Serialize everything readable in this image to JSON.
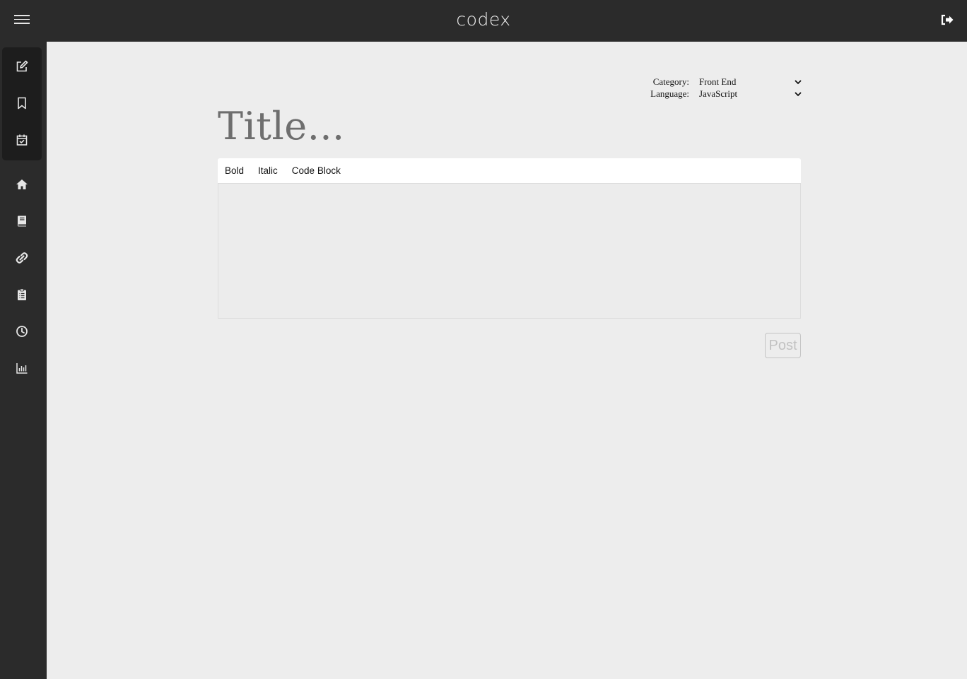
{
  "app": {
    "logo": "codex"
  },
  "header": {
    "menu_icon": "hamburger-menu-icon",
    "logout_icon": "logout-icon"
  },
  "sidebar": {
    "group_items": [
      {
        "icon": "edit-icon"
      },
      {
        "icon": "bookmark-icon"
      },
      {
        "icon": "calendar-check-icon"
      }
    ],
    "items": [
      {
        "icon": "home-icon"
      },
      {
        "icon": "book-icon"
      },
      {
        "icon": "link-icon"
      },
      {
        "icon": "clipboard-list-icon"
      },
      {
        "icon": "clock-icon"
      },
      {
        "icon": "bar-chart-icon"
      }
    ]
  },
  "form": {
    "category": {
      "label": "Category:",
      "value": "Front End"
    },
    "language": {
      "label": "Language:",
      "value": "JavaScript"
    },
    "title_placeholder": "Title...",
    "toolbar": {
      "bold": "Bold",
      "italic": "Italic",
      "code_block": "Code Block"
    },
    "body_value": "",
    "post_label": "Post"
  },
  "colors": {
    "bar": "#2b2b2b",
    "sidebar_group": "#1d1d1d",
    "background": "#ededed"
  }
}
